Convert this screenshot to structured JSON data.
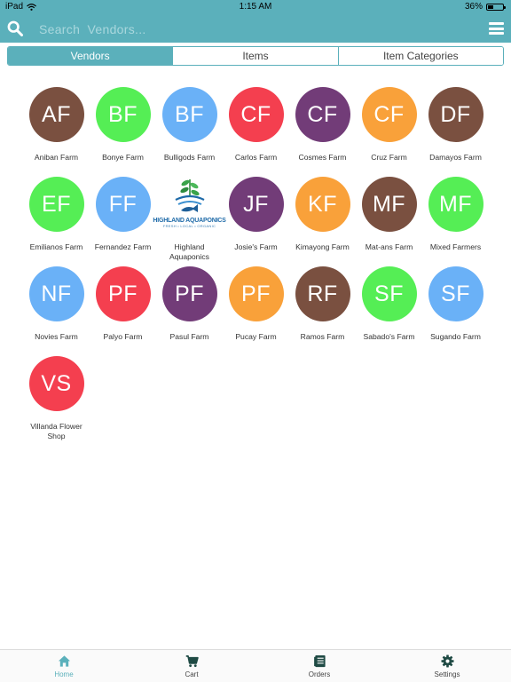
{
  "status_bar": {
    "device": "iPad",
    "time": "1:15 AM",
    "battery": "36%",
    "battery_level": 0.36
  },
  "search": {
    "placeholder": "Search  Vendors..."
  },
  "tabs": [
    {
      "label": "Vendors",
      "active": true
    },
    {
      "label": "Items",
      "active": false
    },
    {
      "label": "Item Categories",
      "active": false
    }
  ],
  "colors": {
    "accent": "#5bb0bb",
    "brown": "#7a5040",
    "green": "#55ee55",
    "blue": "#6ab1f7",
    "red": "#f43f4f",
    "purple": "#723c78",
    "orange": "#f9a13a"
  },
  "vendors": [
    {
      "initials": "AF",
      "name": "Aniban Farm",
      "color": "brown"
    },
    {
      "initials": "BF",
      "name": "Bonye Farm",
      "color": "green"
    },
    {
      "initials": "BF",
      "name": "Bulligods Farm",
      "color": "blue"
    },
    {
      "initials": "CF",
      "name": "Carlos Farm",
      "color": "red"
    },
    {
      "initials": "CF",
      "name": "Cosmes Farm",
      "color": "purple"
    },
    {
      "initials": "CF",
      "name": "Cruz Farm",
      "color": "orange"
    },
    {
      "initials": "DF",
      "name": "Damayos Farm",
      "color": "brown"
    },
    {
      "initials": "EF",
      "name": "Emilianos Farm",
      "color": "green"
    },
    {
      "initials": "FF",
      "name": "Fernandez Farm",
      "color": "blue"
    },
    {
      "initials": "",
      "name": "Highland Aquaponics",
      "logo": true,
      "logo_text": "HIGHLAND AQUAPONICS",
      "logo_sub": "FRESH • LOCAL • ORGANIC"
    },
    {
      "initials": "JF",
      "name": "Josie's Farm",
      "color": "purple"
    },
    {
      "initials": "KF",
      "name": "Kimayong Farm",
      "color": "orange"
    },
    {
      "initials": "MF",
      "name": "Mat-ans Farm",
      "color": "brown"
    },
    {
      "initials": "MF",
      "name": "Mixed Farmers",
      "color": "green"
    },
    {
      "initials": "NF",
      "name": "Novies Farm",
      "color": "blue"
    },
    {
      "initials": "PF",
      "name": "Palyo Farm",
      "color": "red"
    },
    {
      "initials": "PF",
      "name": "Pasul Farm",
      "color": "purple"
    },
    {
      "initials": "PF",
      "name": "Pucay Farm",
      "color": "orange"
    },
    {
      "initials": "RF",
      "name": "Ramos Farm",
      "color": "brown"
    },
    {
      "initials": "SF",
      "name": "Sabado's Farm",
      "color": "green"
    },
    {
      "initials": "SF",
      "name": "Sugando Farm",
      "color": "blue"
    },
    {
      "initials": "VS",
      "name": "Villanda Flower Shop",
      "color": "red"
    }
  ],
  "bottom_tabs": [
    {
      "label": "Home",
      "icon": "home-icon",
      "active": true
    },
    {
      "label": "Cart",
      "icon": "cart-icon",
      "active": false
    },
    {
      "label": "Orders",
      "icon": "orders-icon",
      "active": false
    },
    {
      "label": "Settings",
      "icon": "settings-icon",
      "active": false
    }
  ]
}
